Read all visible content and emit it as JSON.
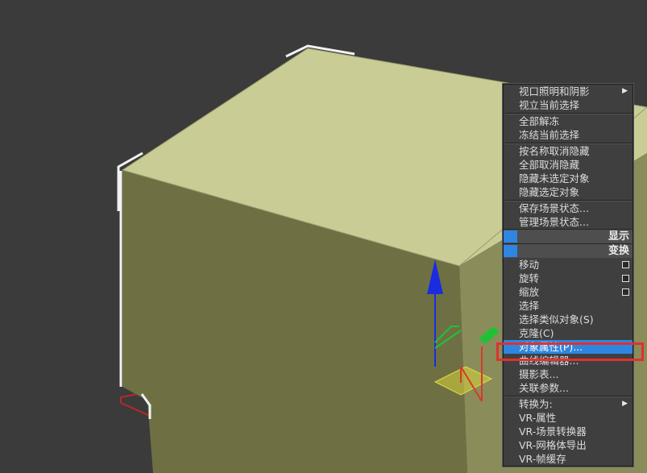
{
  "colors": {
    "viewport_bg": "#3b3b3b",
    "box_top": "#c9cc95",
    "box_front": "#6e7044",
    "box_side": "#8f9160",
    "selection_white": "#f2f2f2",
    "menu_bg": "#3f3f3f",
    "menu_highlight": "#2f86e0",
    "annotation_red": "#e2312d",
    "gizmo_z": "#1b2be0",
    "gizmo_y": "#23c037",
    "gizmo_x": "#d63a2a"
  },
  "menu": {
    "viewport_lighting": "视口照明和阴影",
    "isolate_selection": "视立当前选择",
    "unfreeze_all": "全部解冻",
    "freeze_selection": "冻结当前选择",
    "unhide_by_name": "按名称取消隐藏",
    "unhide_all": "全部取消隐藏",
    "hide_unselected": "隐藏未选定对象",
    "hide_selection": "隐藏选定对象",
    "save_scene_state": "保存场景状态...",
    "manage_scene_states": "管理场景状态...",
    "display_header": "显示",
    "transform_header": "变换",
    "move": "移动",
    "rotate": "旋转",
    "scale": "缩放",
    "select": "选择",
    "select_similar": "选择类似对象(S)",
    "clone": "克隆(C)",
    "object_properties": "对象属性(P)...",
    "curve_editor": "曲线编辑器...",
    "dope_sheet": "摄影表...",
    "wire_parameters": "关联参数...",
    "convert_to": "转换为:",
    "vr_properties": "VR-属性",
    "vr_scene_converter": "VR-场景转换器",
    "vr_mesh_export": "VR-网格体导出",
    "vr_frame_buffer": "VR-帧缓存"
  },
  "icons": {
    "submenu_arrow": "triangle-right-icon",
    "settings_box": "settings-box-icon"
  }
}
